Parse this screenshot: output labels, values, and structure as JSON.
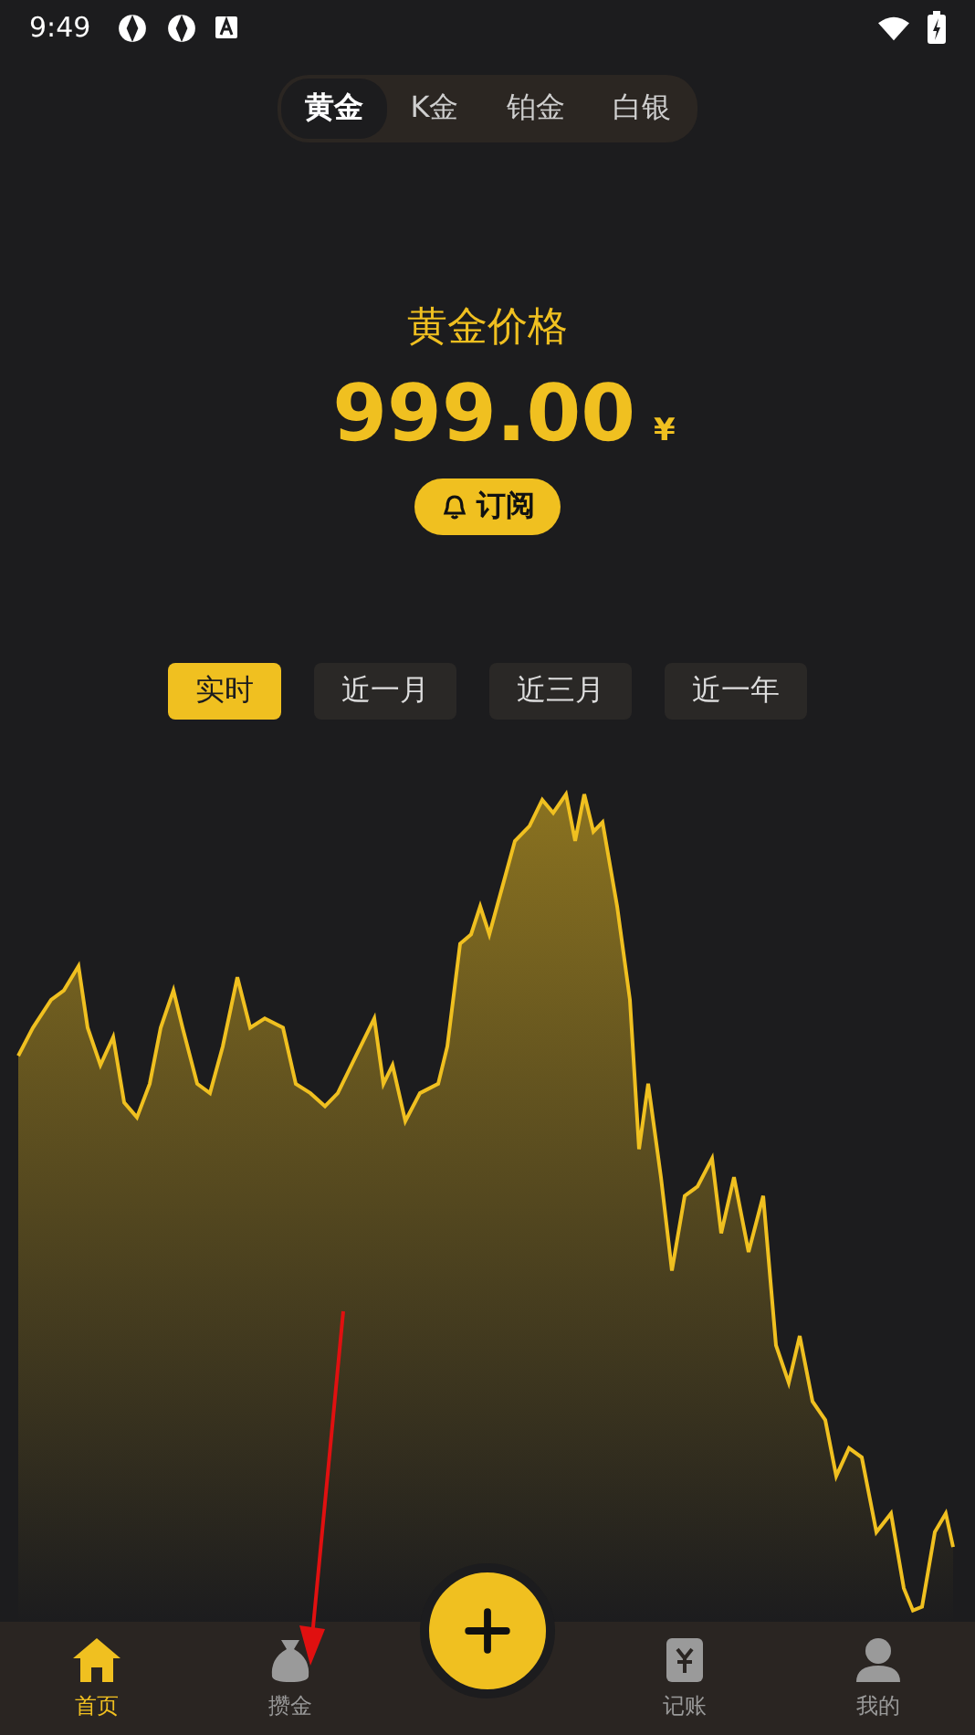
{
  "status_bar": {
    "time": "9:49"
  },
  "metal_tabs": [
    {
      "label": "黄金",
      "selected": true
    },
    {
      "label": "K金",
      "selected": false
    },
    {
      "label": "铂金",
      "selected": false
    },
    {
      "label": "白银",
      "selected": false
    }
  ],
  "price": {
    "title": "黄金价格",
    "value": "999.00",
    "currency": "¥"
  },
  "subscribe_button": {
    "label": "订阅"
  },
  "ranges": [
    {
      "label": "实时",
      "selected": true
    },
    {
      "label": "近一月",
      "selected": false
    },
    {
      "label": "近三月",
      "selected": false
    },
    {
      "label": "近一年",
      "selected": false
    }
  ],
  "bottom_nav": [
    {
      "label": "首页",
      "kind": "home",
      "selected": true
    },
    {
      "label": "攒金",
      "kind": "bag",
      "selected": false
    },
    {
      "kind": "add"
    },
    {
      "label": "记账",
      "kind": "ledger",
      "selected": false
    },
    {
      "label": "我的",
      "kind": "profile",
      "selected": false
    }
  ]
}
